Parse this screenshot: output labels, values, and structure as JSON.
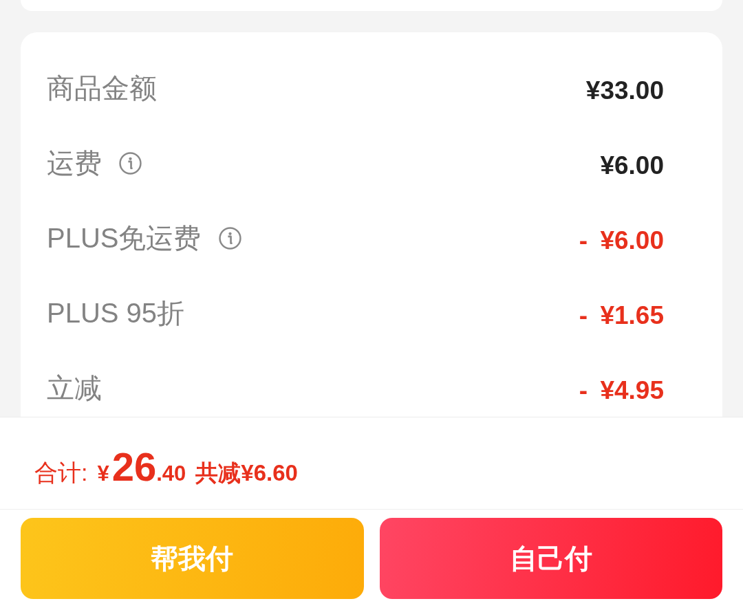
{
  "summary_card": {
    "rows": [
      {
        "label": "商品金额",
        "info": false,
        "kind": "amount",
        "value": "¥33.00"
      },
      {
        "label": "运费",
        "info": true,
        "kind": "amount",
        "value": "¥6.00"
      },
      {
        "label": "PLUS免运费",
        "info": true,
        "kind": "discount",
        "value": "- ¥6.00"
      },
      {
        "label": "PLUS 95折",
        "info": false,
        "kind": "discount",
        "value": "- ¥1.65"
      },
      {
        "label": "立减",
        "info": false,
        "kind": "discount",
        "value": "- ¥4.95"
      }
    ]
  },
  "total_bar": {
    "label": "合计:",
    "currency": "¥",
    "integer": "26",
    "decimal": ".40",
    "saving": "共减¥6.60"
  },
  "buttons": [
    {
      "label": "帮我付",
      "kind": "friend_pay"
    },
    {
      "label": "自己付",
      "kind": "self_pay"
    }
  ]
}
